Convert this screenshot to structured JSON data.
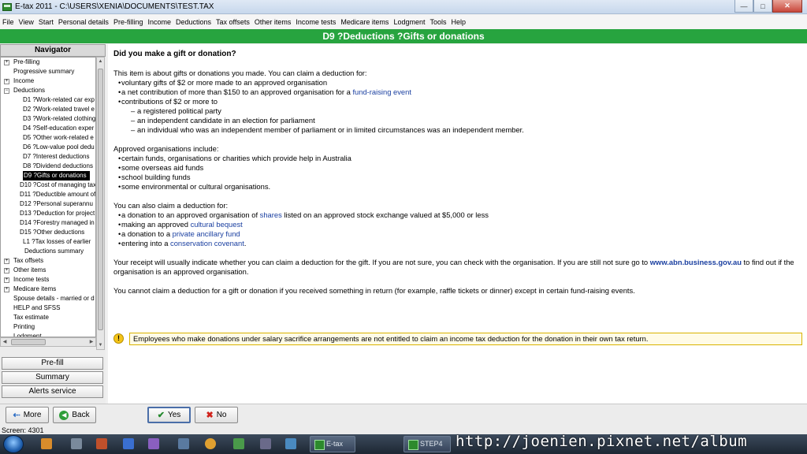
{
  "window": {
    "title": "E-tax 2011 - C:\\USERS\\XENIA\\DOCUMENTS\\TEST.TAX",
    "controls": [
      "—",
      "□",
      "✕"
    ]
  },
  "menu": [
    "File",
    "View",
    "Start",
    "Personal details",
    "Pre-filling",
    "Income",
    "Deductions",
    "Tax offsets",
    "Other items",
    "Income tests",
    "Medicare items",
    "Lodgment",
    "Tools",
    "Help"
  ],
  "header": {
    "title": "D9 ?Deductions ?Gifts or donations"
  },
  "navigator": {
    "title": "Navigator",
    "items": [
      {
        "label": "Pre-filling",
        "toggle": "+",
        "indent": 0
      },
      {
        "label": "Progressive summary",
        "toggle": "",
        "indent": 0
      },
      {
        "label": "Income",
        "toggle": "+",
        "indent": 0
      },
      {
        "label": "Deductions",
        "toggle": "−",
        "indent": 0
      },
      {
        "label": "D1 ?Work-related car exp",
        "toggle": "",
        "indent": 2
      },
      {
        "label": "D2 ?Work-related travel e",
        "toggle": "",
        "indent": 2
      },
      {
        "label": "D3 ?Work-related clothing",
        "toggle": "",
        "indent": 2
      },
      {
        "label": "D4 ?Self-education exper",
        "toggle": "",
        "indent": 2
      },
      {
        "label": "D5 ?Other work-related e",
        "toggle": "",
        "indent": 2
      },
      {
        "label": "D6 ?Low-value pool dedu",
        "toggle": "",
        "indent": 2
      },
      {
        "label": "D7 ?Interest deductions",
        "toggle": "",
        "indent": 2
      },
      {
        "label": "D8 ?Dividend deductions",
        "toggle": "",
        "indent": 2
      },
      {
        "label": "D9 ?Gifts or donations",
        "toggle": "",
        "indent": 2,
        "selected": true
      },
      {
        "label": "D10 ?Cost of managing tax",
        "toggle": "",
        "indent": 1
      },
      {
        "label": "D11 ?Deductible amount of",
        "toggle": "",
        "indent": 1
      },
      {
        "label": "D12 ?Personal superannu",
        "toggle": "",
        "indent": 1
      },
      {
        "label": "D13 ?Deduction for project",
        "toggle": "",
        "indent": 1
      },
      {
        "label": "D14 ?Forestry managed in",
        "toggle": "",
        "indent": 1
      },
      {
        "label": "D15 ?Other deductions",
        "toggle": "",
        "indent": 1
      },
      {
        "label": "L1 ?Tax losses of earlier",
        "toggle": "",
        "indent": 2
      },
      {
        "label": "Deductions summary",
        "toggle": "",
        "indent": 1.5
      },
      {
        "label": "Tax offsets",
        "toggle": "+",
        "indent": 0
      },
      {
        "label": "Other items",
        "toggle": "+",
        "indent": 0
      },
      {
        "label": "Income tests",
        "toggle": "+",
        "indent": 0
      },
      {
        "label": "Medicare items",
        "toggle": "+",
        "indent": 0
      },
      {
        "label": "Spouse details - married or d",
        "toggle": "",
        "indent": 0
      },
      {
        "label": "HELP and SFSS",
        "toggle": "",
        "indent": 0
      },
      {
        "label": "Tax estimate",
        "toggle": "",
        "indent": 0
      },
      {
        "label": "Printing",
        "toggle": "",
        "indent": 0
      },
      {
        "label": "Lodgment",
        "toggle": "",
        "indent": 0
      }
    ],
    "buttons": [
      "Pre-fill",
      "Summary",
      "Alerts service"
    ]
  },
  "content": {
    "question": "Did you make a gift or donation?",
    "intro": "This item is about gifts or donations you made. You can claim a deduction for:",
    "bullets1": [
      {
        "text": "voluntary gifts of $2 or more made to an approved organisation"
      },
      {
        "text": "a net contribution of more than $150 to an approved organisation for a ",
        "link": "fund-raising event"
      },
      {
        "text": "contributions of $2 or more to"
      }
    ],
    "dashes": [
      "a registered political party",
      "an independent candidate in an election for parliament",
      "an individual who was an independent member of parliament or in limited circumstances was an independent member."
    ],
    "approved_heading": "Approved organisations include:",
    "bullets2": [
      "certain funds, organisations or charities which provide help in Australia",
      "some overseas aid funds",
      "school building funds",
      "some environmental or cultural organisations."
    ],
    "also_heading": "You can also claim a deduction for:",
    "bullets3": [
      {
        "pre": "a donation to an approved organisation of ",
        "link": "shares",
        "post": " listed on an approved stock exchange valued at $5,000 or less"
      },
      {
        "pre": "making an approved ",
        "link": "cultural bequest",
        "post": ""
      },
      {
        "pre": "a donation to a ",
        "link": "private ancillary fund",
        "post": ""
      },
      {
        "pre": "entering into a ",
        "link": "conservation covenant",
        "post": "."
      }
    ],
    "receipt_pre": "Your receipt will usually indicate whether you can claim a deduction for the gift. If you are not sure, you can check with the organisation. If you are still not sure go to ",
    "receipt_link": "www.abn.business.gov.au",
    "receipt_post": " to find out if the organisation is an approved organisation.",
    "cannot": "You cannot claim a deduction for a gift or donation if you received something in return (for example, raffle tickets or dinner) except in certain fund-raising events.",
    "alert": "Employees who make donations under salary sacrifice arrangements are not entitled to claim an income tax deduction for the donation in their own tax return."
  },
  "bottom": {
    "more": "More",
    "back": "Back",
    "yes": "Yes",
    "no": "No"
  },
  "status": {
    "text": "Screen: 4301"
  },
  "taskbar": {
    "task1": "E-tax 2011",
    "task2": "STEP4",
    "watermark": "http://joenien.pixnet.net/album"
  }
}
